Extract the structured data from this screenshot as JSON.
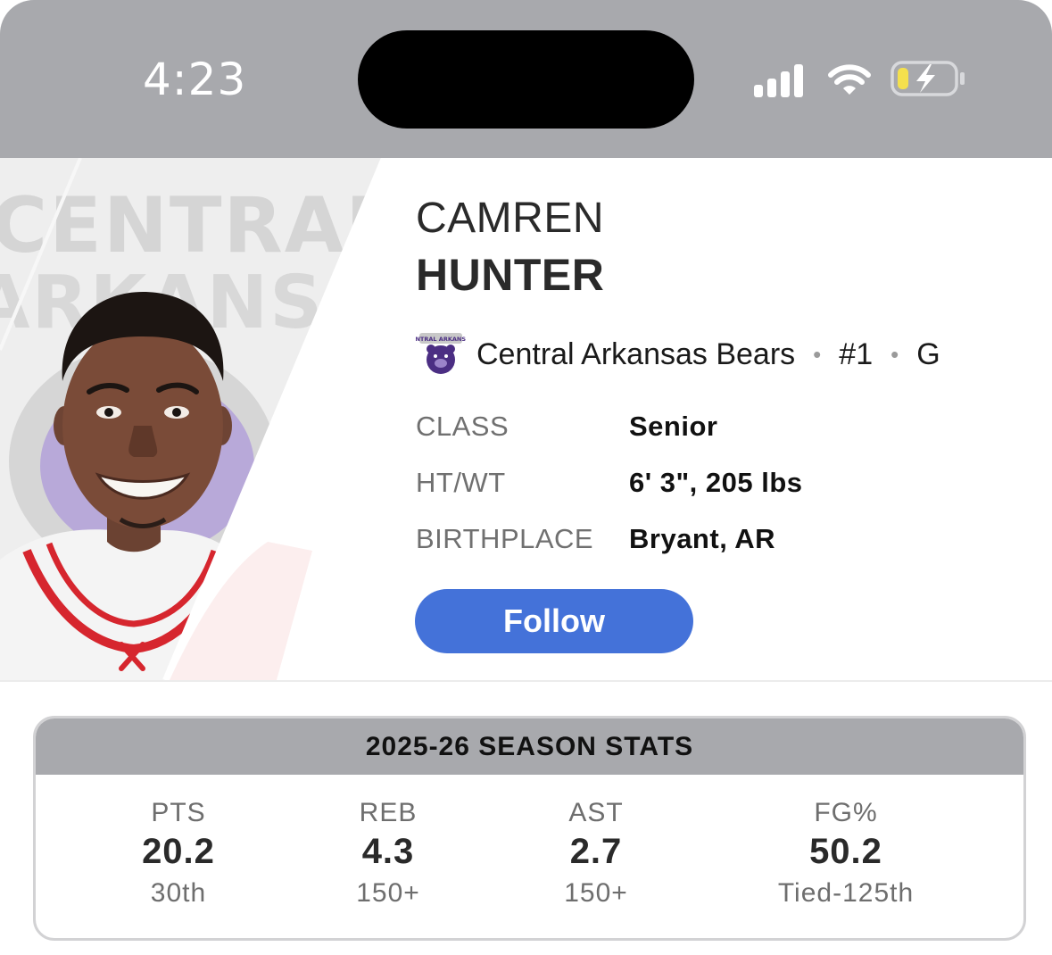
{
  "status_bar": {
    "time": "4:23",
    "icons": [
      "signal-icon",
      "wifi-icon",
      "battery-charging-icon"
    ]
  },
  "player": {
    "first_name": "CAMREN",
    "last_name": "HUNTER",
    "team": "Central Arkansas Bears",
    "number": "#1",
    "position": "G",
    "team_logo_text": "CENTRAL ARKANSAS",
    "photo_background_text": [
      "CENTRAL",
      "ARKANSAS"
    ]
  },
  "info": [
    {
      "label": "CLASS",
      "value": "Senior"
    },
    {
      "label": "HT/WT",
      "value": "6' 3\", 205 lbs"
    },
    {
      "label": "BIRTHPLACE",
      "value": "Bryant, AR"
    }
  ],
  "follow_label": "Follow",
  "season_stats": {
    "title": "2025-26 SEASON STATS",
    "stats": [
      {
        "label": "PTS",
        "value": "20.2",
        "rank": "30th"
      },
      {
        "label": "REB",
        "value": "4.3",
        "rank": "150+"
      },
      {
        "label": "AST",
        "value": "2.7",
        "rank": "150+"
      },
      {
        "label": "FG%",
        "value": "50.2",
        "rank": "Tied-125th"
      }
    ]
  },
  "colors": {
    "status_bar": "#a8a9ad",
    "follow_button": "#4472d9",
    "team_purple": "#4b2e83",
    "jersey_red": "#d6262e"
  }
}
